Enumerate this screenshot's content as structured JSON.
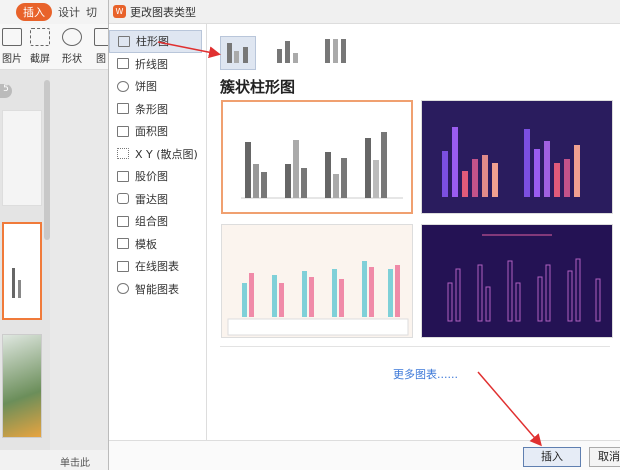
{
  "ribbon": {
    "tabs": [
      "插入",
      "设计",
      "切"
    ],
    "tools": [
      "图片",
      "截屏",
      "形状",
      "图"
    ]
  },
  "slides": {
    "number": "5"
  },
  "statusbar": {
    "hint": "单击此"
  },
  "dialog": {
    "title": "更改图表类型",
    "nav": [
      {
        "label": "柱形图",
        "icon": "bar-chart-icon"
      },
      {
        "label": "折线图",
        "icon": "line-chart-icon"
      },
      {
        "label": "饼图",
        "icon": "pie-chart-icon"
      },
      {
        "label": "条形图",
        "icon": "horizontal-bar-icon"
      },
      {
        "label": "面积图",
        "icon": "area-chart-icon"
      },
      {
        "label": "X Y (散点图)",
        "icon": "scatter-chart-icon"
      },
      {
        "label": "股价图",
        "icon": "stock-chart-icon"
      },
      {
        "label": "雷达图",
        "icon": "radar-chart-icon"
      },
      {
        "label": "组合图",
        "icon": "combo-chart-icon"
      },
      {
        "label": "模板",
        "icon": "template-icon"
      },
      {
        "label": "在线图表",
        "icon": "online-chart-icon"
      },
      {
        "label": "智能图表",
        "icon": "smart-chart-icon"
      }
    ],
    "subtype_title": "簇状柱形图",
    "more_link": "更多图表......",
    "insert_button": "插入",
    "cancel_button": "取消"
  }
}
